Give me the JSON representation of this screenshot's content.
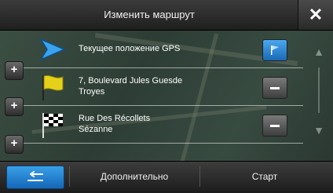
{
  "header": {
    "title": "Изменить маршрут",
    "close_icon": "close-icon"
  },
  "route_points": [
    {
      "label": "Текущее положение GPS",
      "icon": "gps-position-icon",
      "action_icon": "flag-icon"
    },
    {
      "label_line1": "7, Boulevard Jules Guesde",
      "label_line2": "Troyes",
      "icon": "waypoint-flag-icon",
      "action_icon": "remove-icon"
    },
    {
      "label_line1": "Rue Des Récollets",
      "label_line2": "Sézanne",
      "icon": "destination-checkered-flag-icon",
      "action_icon": "remove-icon"
    }
  ],
  "add_buttons": [
    "+",
    "+",
    "+"
  ],
  "scroll": {
    "up_icon": "scroll-up-icon",
    "down_icon": "scroll-down-icon"
  },
  "footer": {
    "back_icon": "back-arrow-icon",
    "more_label": "Дополнительно",
    "start_label": "Старт"
  },
  "colors": {
    "accent": "#1f7fd0",
    "bar": "#2a2a2a"
  }
}
